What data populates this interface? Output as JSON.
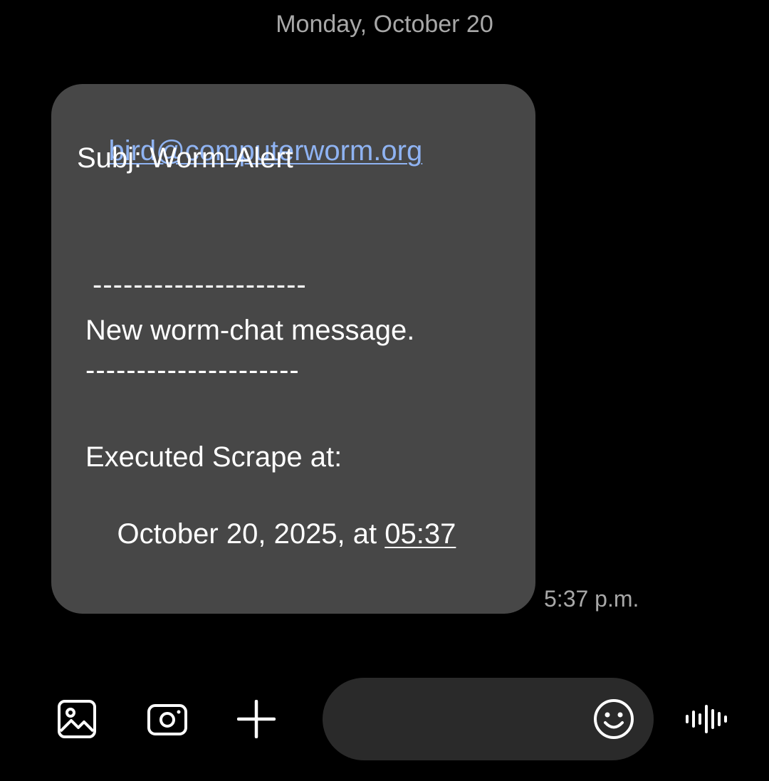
{
  "conversation": {
    "date_header": "Monday, October 20"
  },
  "message": {
    "sender_email": "bird@computerworm.org",
    "subject": "Subj: Worm-Alert",
    "divider_top": "---------------------",
    "body_line": "New worm-chat message.",
    "divider_bottom": "---------------------",
    "executed_label": "Executed Scrape at:",
    "executed_date_prefix": "October 20, 2025, at ",
    "executed_time": "05:37",
    "timestamp": "5:37 p.m.",
    "bubble_color": "#474747",
    "link_color": "#8fb3f2"
  },
  "composer": {
    "gallery_icon": "gallery-icon",
    "camera_icon": "camera-icon",
    "add_icon": "plus-icon",
    "input_value": "",
    "input_placeholder": "",
    "emoji_icon": "emoji-icon",
    "voice_icon": "voice-waveform-icon",
    "pill_color": "#2a2a2a"
  }
}
